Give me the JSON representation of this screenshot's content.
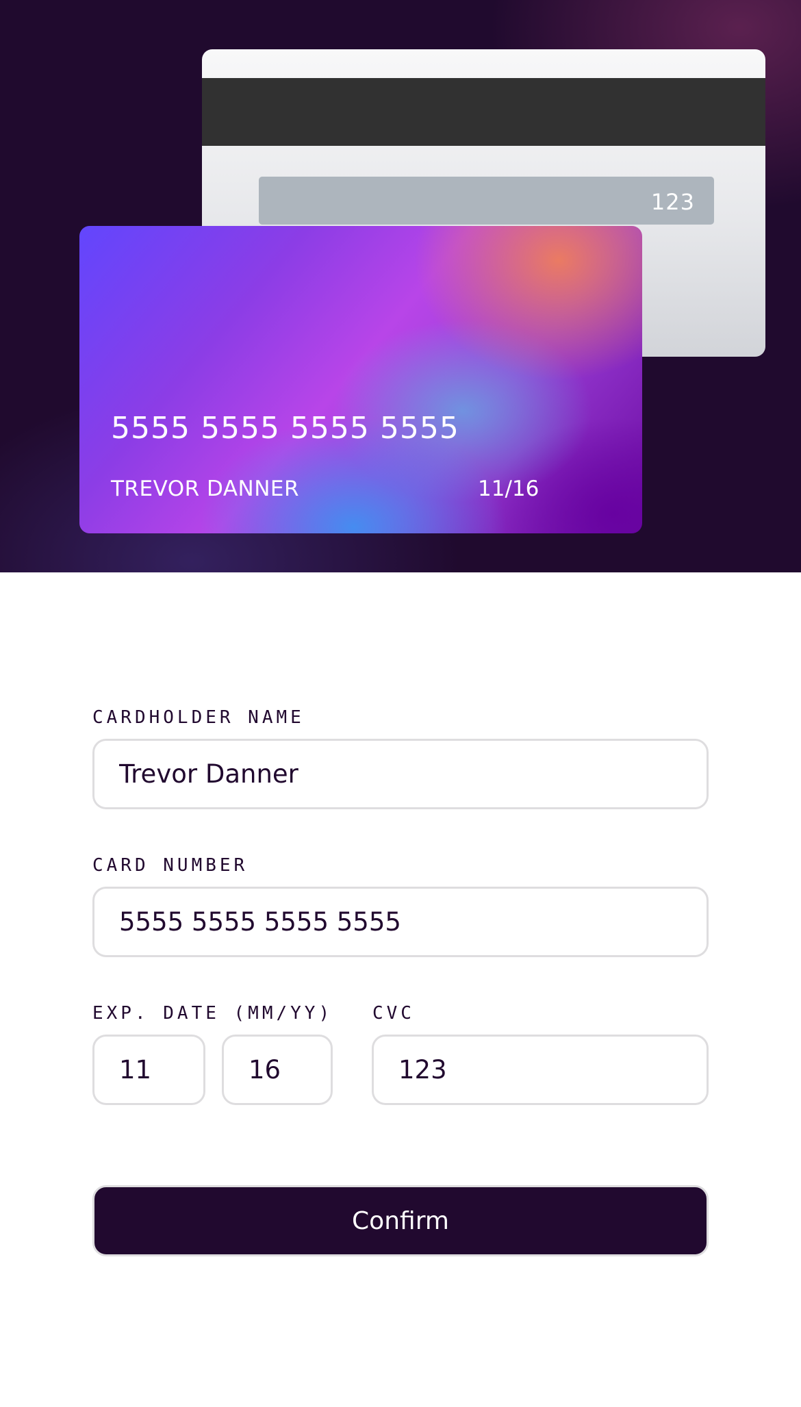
{
  "card_back": {
    "cvc": "123"
  },
  "card_front": {
    "number": "5555 5555 5555 5555",
    "holder": "TREVOR DANNER",
    "expiry": "11/16"
  },
  "form": {
    "cardholder_label": "CARDHOLDER NAME",
    "cardholder_value": "Trevor Danner",
    "number_label": "CARD NUMBER",
    "number_value": "5555 5555 5555 5555",
    "exp_label": "EXP. DATE (MM/YY)",
    "exp_month_value": "11",
    "exp_year_value": "16",
    "cvc_label": "CVC",
    "cvc_value": "123",
    "confirm_label": "Confirm"
  },
  "colors": {
    "dark_violet": "#21092f",
    "input_border": "#dedddf",
    "card_gradient_start": "#6246fd",
    "card_gradient_end": "#6a0aa0"
  }
}
